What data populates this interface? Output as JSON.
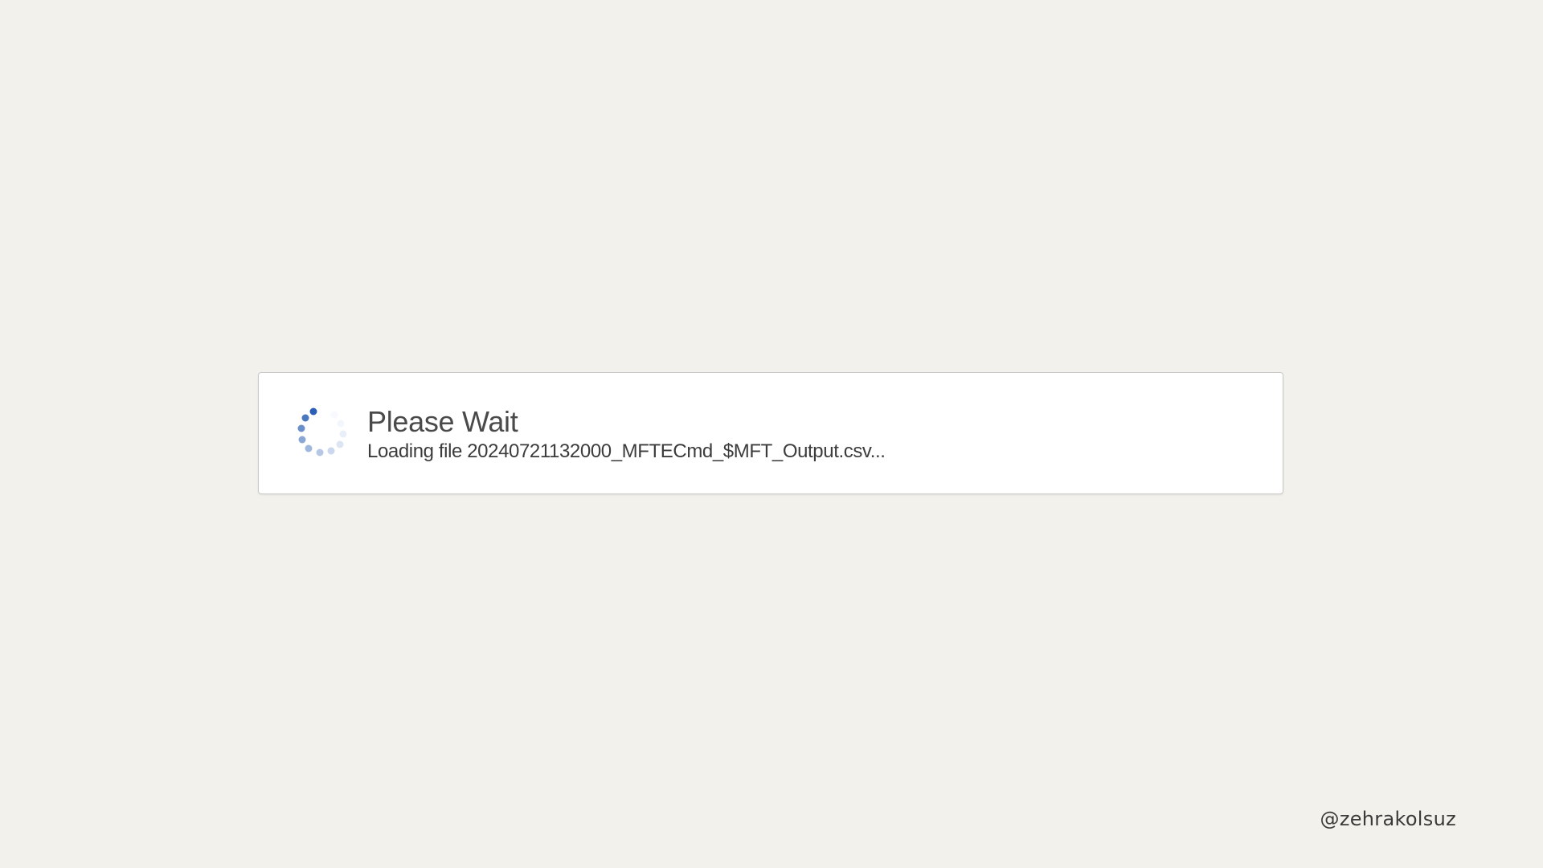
{
  "dialog": {
    "title": "Please Wait",
    "message": "Loading file 20240721132000_MFTECmd_$MFT_Output.csv...",
    "spinner_icon": "loading-spinner-icon",
    "spinner_color": "#2b5fb4"
  },
  "watermark": {
    "text": "@zehrakolsuz"
  },
  "colors": {
    "background": "#f3f1ec",
    "dialog_background": "#ffffff",
    "dialog_border": "#c9c9c9"
  }
}
